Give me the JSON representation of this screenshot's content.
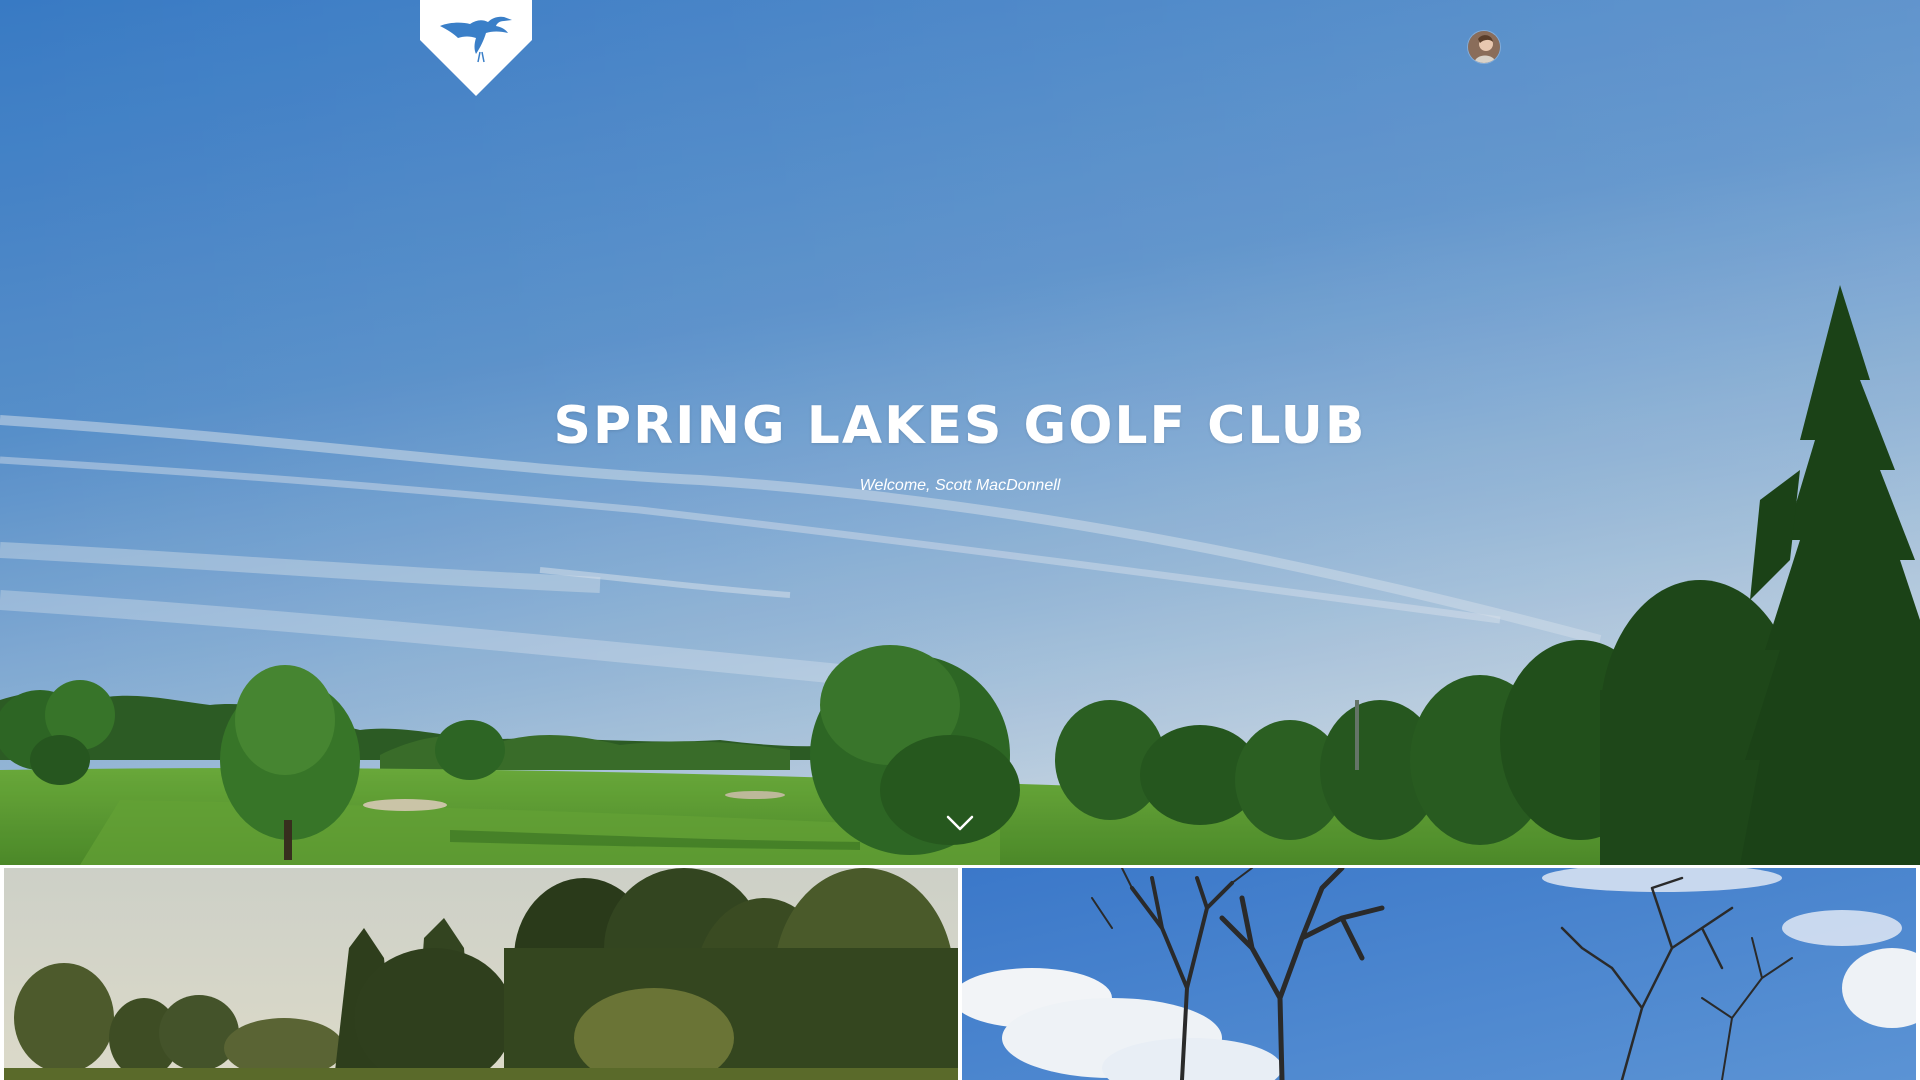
{
  "header": {
    "logo_icon": "heron-icon",
    "logo_color": "#3a7fc8",
    "avatar_icon": "user-avatar"
  },
  "hero": {
    "title": "SPRING LAKES GOLF CLUB",
    "subtitle": "Welcome, Scott MacDonnell",
    "scroll_icon": "chevron-down-icon",
    "sky_color_top": "#3b82cf",
    "grass_color": "#5c9e2e"
  },
  "tiles": [
    {
      "name": "course-photo-tile-1",
      "image": "trees-under-hazy-sky"
    },
    {
      "name": "course-photo-tile-2",
      "image": "bare-trees-under-blue-sky"
    }
  ]
}
